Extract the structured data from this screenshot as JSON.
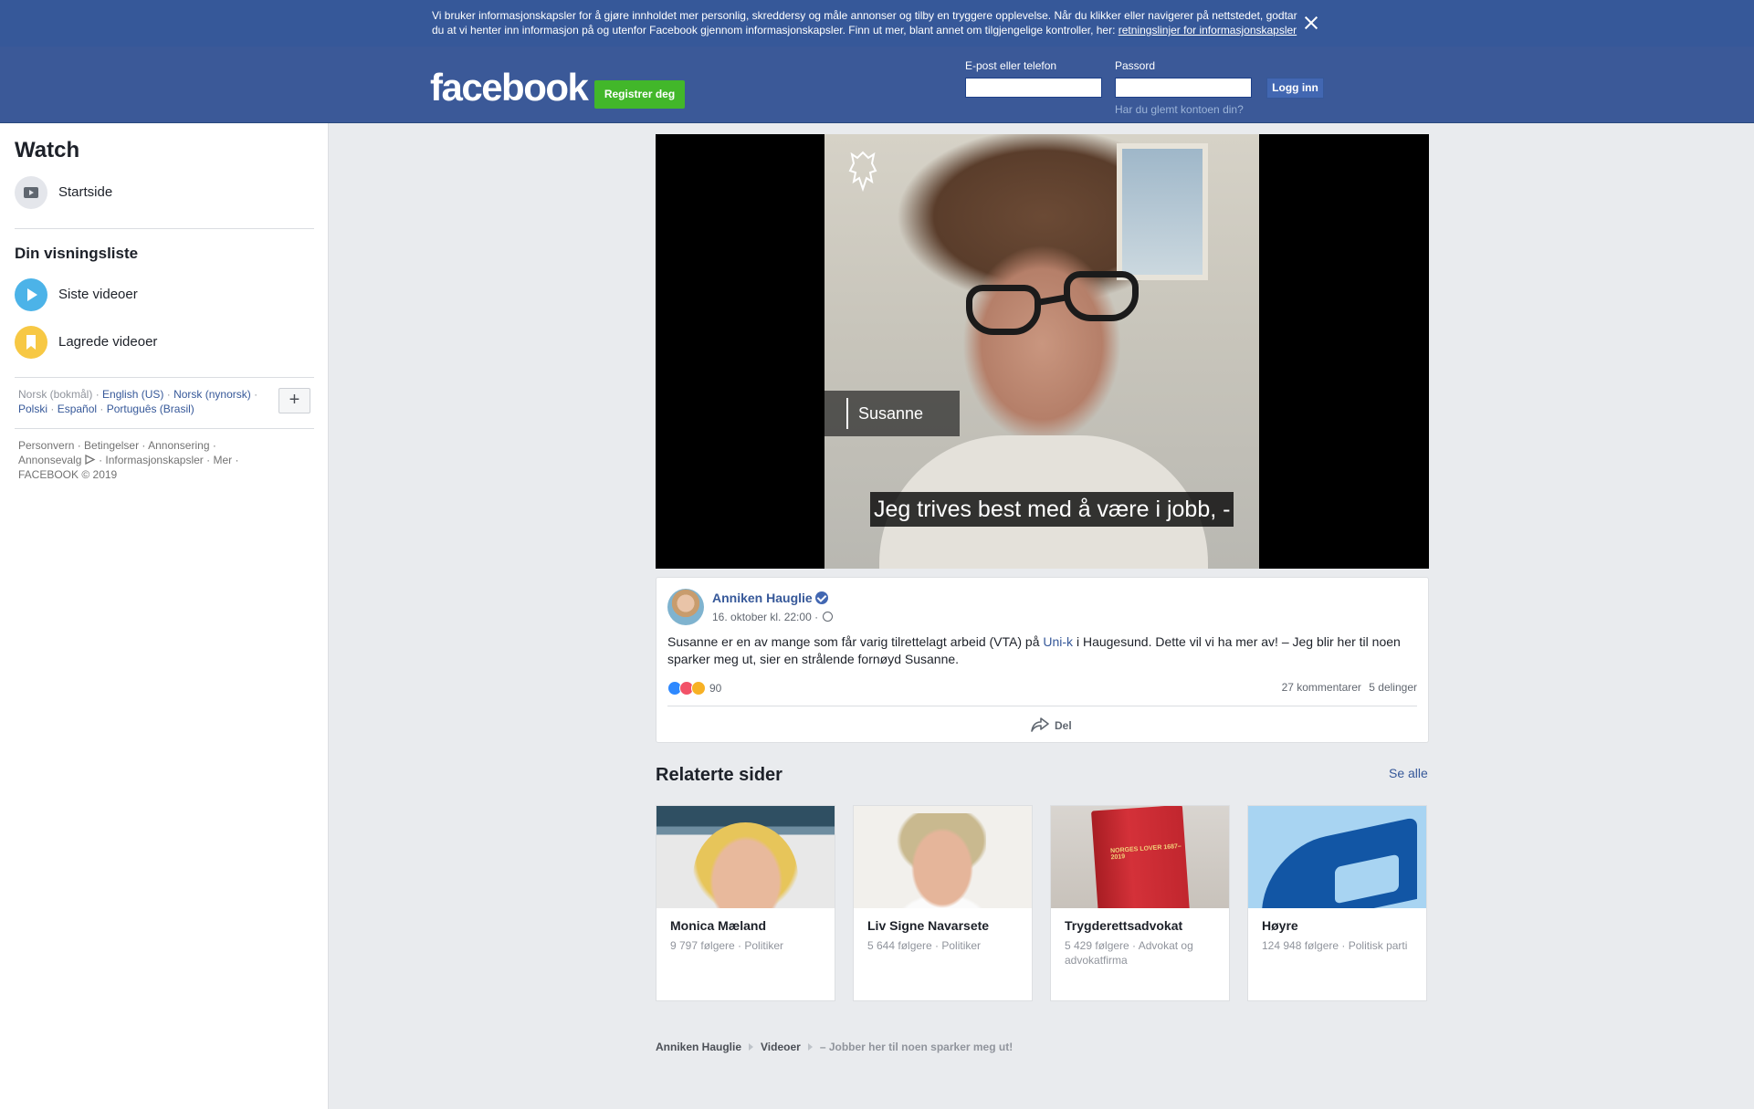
{
  "cookie_banner": {
    "text": "Vi bruker informasjonskapsler for å gjøre innholdet mer personlig, skreddersy og måle annonser og tilby en tryggere opplevelse. Når du klikker eller navigerer på nettstedet, godtar du at vi henter inn informasjon på og utenfor Facebook gjennom informasjonskapsler. Finn ut mer, blant annet om tilgjengelige kontroller, her: ",
    "link": "retningslinjer for informasjonskapsler"
  },
  "header": {
    "logo": "facebook",
    "register_label": "Registrer deg",
    "email_label": "E-post eller telefon",
    "email_value": "",
    "password_label": "Passord",
    "password_value": "",
    "login_label": "Logg inn",
    "forgot": "Har du glemt kontoen din?"
  },
  "sidebar": {
    "title": "Watch",
    "home": "Startside",
    "section": "Din visningsliste",
    "latest": "Siste videoer",
    "saved": "Lagrede videoer",
    "current_language": "Norsk (bokmål)",
    "languages": [
      "English (US)",
      "Norsk (nynorsk)",
      "Polski",
      "Español",
      "Português (Brasil)"
    ],
    "more_languages": "+",
    "footer_links": [
      "Personvern",
      "Betingelser",
      "Annonsering",
      "Annonsevalg",
      "Informasjonskapsler",
      "Mer"
    ],
    "copyright": "FACEBOOK © 2019"
  },
  "video": {
    "name_tag": "Susanne",
    "subtitle": "Jeg trives best med å være i jobb, -"
  },
  "post": {
    "author": "Anniken Hauglie",
    "date": "16. oktober kl. 22:00 ·",
    "text_before": "Susanne er en av mange som får varig tilrettelagt arbeid (VTA) på ",
    "text_link": "Uni-k",
    "text_after": " i Haugesund. Dette vil vi ha mer av! – Jeg blir her til noen sparker meg ut, sier en strålende fornøyd Susanne.",
    "reactions": "90",
    "comments": "27 kommentarer",
    "shares": "5 delinger",
    "share_label": "Del"
  },
  "related": {
    "title": "Relaterte sider",
    "see_all": "Se alle",
    "pages": [
      {
        "name": "Monica Mæland",
        "info": "9 797 følgere · Politiker"
      },
      {
        "name": "Liv Signe Navarsete",
        "info": "5 644 følgere · Politiker"
      },
      {
        "name": "Trygderettsadvokat",
        "info": "5 429 følgere · Advokat og advokatfirma",
        "image_text": "NORGES LOVER 1687–2019"
      },
      {
        "name": "Høyre",
        "info": "124 948 følgere · Politisk parti"
      }
    ]
  },
  "breadcrumb": [
    "Anniken Hauglie",
    "Videoer",
    "– Jobber her til noen sparker meg ut!"
  ],
  "colors": {
    "brand": "#3b5998",
    "cookie_bar": "#365899",
    "register": "#42b72a",
    "link": "#365899"
  }
}
